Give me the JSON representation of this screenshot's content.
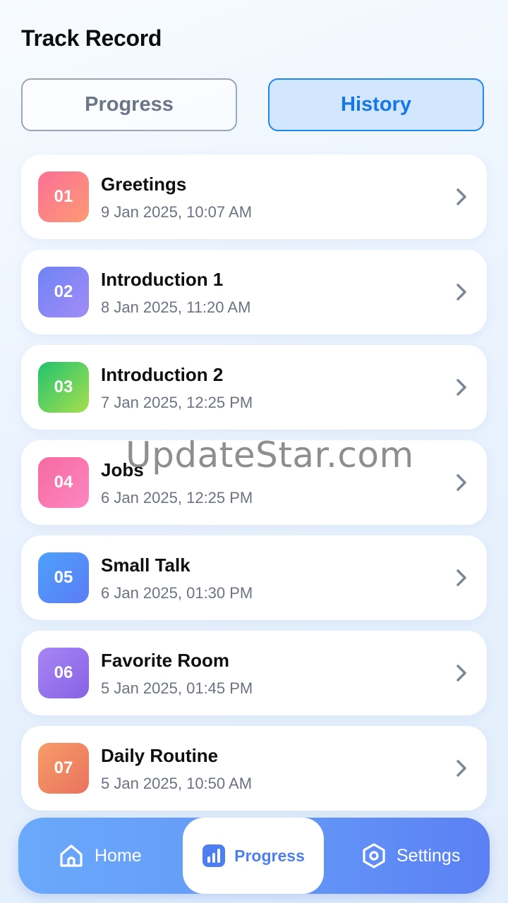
{
  "header": {
    "title": "Track Record"
  },
  "segments": {
    "progress_label": "Progress",
    "history_label": "History",
    "selected": "History"
  },
  "history": [
    {
      "number": "01",
      "title": "Greetings",
      "date": "9 Jan 2025, 10:07 AM"
    },
    {
      "number": "02",
      "title": "Introduction 1",
      "date": "8 Jan 2025, 11:20 AM"
    },
    {
      "number": "03",
      "title": "Introduction 2",
      "date": "7 Jan 2025, 12:25 PM"
    },
    {
      "number": "04",
      "title": "Jobs",
      "date": "6 Jan 2025, 12:25 PM"
    },
    {
      "number": "05",
      "title": "Small Talk",
      "date": "6 Jan 2025, 01:30 PM"
    },
    {
      "number": "06",
      "title": "Favorite Room",
      "date": "5 Jan 2025, 01:45 PM"
    },
    {
      "number": "07",
      "title": "Daily Routine",
      "date": "5 Jan 2025, 10:50 AM"
    }
  ],
  "watermark": "UpdateStar.com",
  "bottom_nav": {
    "home_label": "Home",
    "progress_label": "Progress",
    "settings_label": "Settings",
    "active": "Progress",
    "home_icon": "home-icon",
    "progress_icon": "bar-chart-icon",
    "settings_icon": "hexagon-gear-icon"
  },
  "colors": {
    "accent": "#1577e8",
    "nav_gradient_start": "#6aa9fb",
    "nav_gradient_end": "#5b80f4"
  }
}
